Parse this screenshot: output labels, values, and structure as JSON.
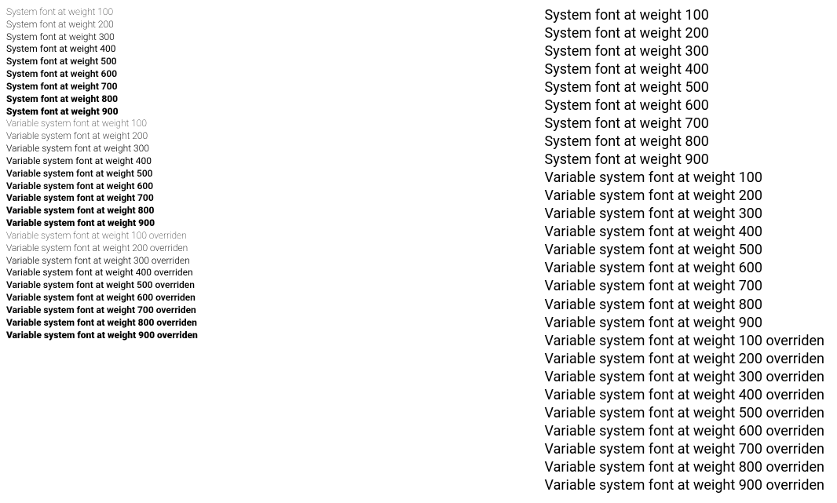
{
  "left": {
    "system": [
      "System font at weight 100",
      "System font at weight 200",
      "System font at weight 300",
      "System font at weight 400",
      "System font at weight 500",
      "System font at weight 600",
      "System font at weight 700",
      "System font at weight 800",
      "System font at weight 900"
    ],
    "variable": [
      "Variable system font at weight 100",
      "Variable system font at weight 200",
      "Variable system font at weight 300",
      "Variable system font at weight 400",
      "Variable system font at weight 500",
      "Variable system font at weight 600",
      "Variable system font at weight 700",
      "Variable system font at weight 800",
      "Variable system font at weight 900"
    ],
    "overridden": [
      "Variable system font at weight 100 overriden",
      "Variable system font at weight 200 overriden",
      "Variable system font at weight 300 overriden",
      "Variable system font at weight 400 overriden",
      "Variable system font at weight 500 overriden",
      "Variable system font at weight 600 overriden",
      "Variable system font at weight 700 overriden",
      "Variable system font at weight 800 overriden",
      "Variable system font at weight 900 overriden"
    ]
  },
  "right": {
    "system": [
      "System font at weight 100",
      "System font at weight 200",
      "System font at weight 300",
      "System font at weight 400",
      "System font at weight 500",
      "System font at weight 600",
      "System font at weight 700",
      "System font at weight 800",
      "System font at weight 900"
    ],
    "variable": [
      "Variable system font at weight 100",
      "Variable system font at weight 200",
      "Variable system font at weight 300",
      "Variable system font at weight 400",
      "Variable system font at weight 500",
      "Variable system font at weight 600",
      "Variable system font at weight 700",
      "Variable system font at weight 800",
      "Variable system font at weight 900"
    ],
    "overridden": [
      "Variable system font at weight 100 overriden",
      "Variable system font at weight 200 overriden",
      "Variable system font at weight 300 overriden",
      "Variable system font at weight 400 overriden",
      "Variable system font at weight 500 overriden",
      "Variable system font at weight 600 overriden",
      "Variable system font at weight 700 overriden",
      "Variable system font at weight 800 overriden",
      "Variable system font at weight 900 overriden"
    ]
  }
}
